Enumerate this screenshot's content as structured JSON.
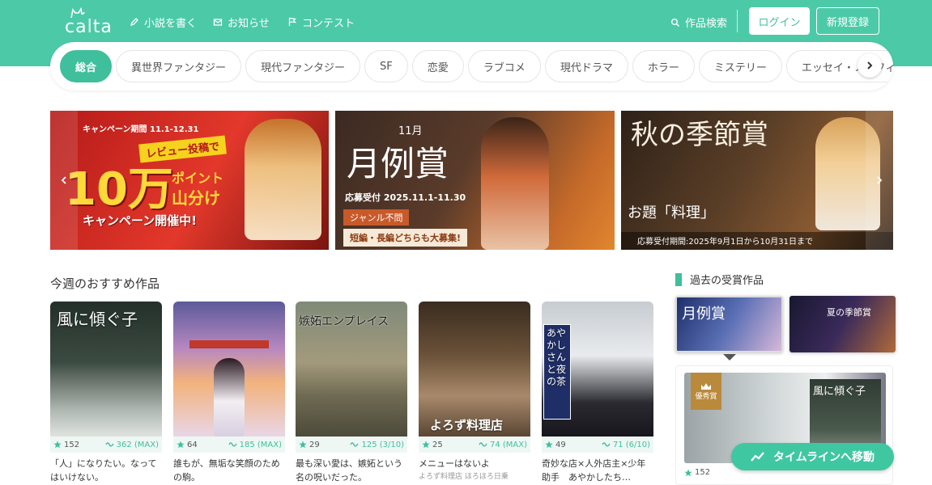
{
  "header": {
    "logo_text": "calta",
    "nav": [
      {
        "label": "小説を書く",
        "icon": "pen-icon"
      },
      {
        "label": "お知らせ",
        "icon": "mail-icon"
      },
      {
        "label": "コンテスト",
        "icon": "flag-icon"
      }
    ],
    "search_label": "作品検索",
    "login_label": "ログイン",
    "signup_label": "新規登録"
  },
  "genres": [
    "総合",
    "異世界ファンタジー",
    "現代ファンタジー",
    "SF",
    "恋愛",
    "ラブコメ",
    "現代ドラマ",
    "ホラー",
    "ミステリー",
    "エッセイ・ノンフィクション"
  ],
  "banners": [
    {
      "top": "キャンペーン期間 11.1-12.31",
      "main1": "レビュー投稿で",
      "main2": "10万",
      "main3": "ポイント",
      "main4": "山分け",
      "main5": "キャンペーン開催中!"
    },
    {
      "month": "11月",
      "title": "月例賞",
      "period": "応募受付 2025.11.1-11.30",
      "genre": "ジャンル不問",
      "note": "短編・長編どちらも大募集!"
    },
    {
      "title": "秋の季節賞",
      "theme": "お題「料理」",
      "period": "応募受付期間:2025年9月1日から10月31日まで"
    }
  ],
  "recommend": {
    "title": "今週のおすすめ作品",
    "items": [
      {
        "cover_title": "風に傾ぐ子",
        "stars": "152",
        "reactions": "362 (MAX)",
        "desc": "「人」になりたい。なってはいけない。",
        "sub": ""
      },
      {
        "cover_title": "",
        "stars": "64",
        "reactions": "185 (MAX)",
        "desc": "誰もが、無垢な笑顔のための駒。",
        "sub": ""
      },
      {
        "cover_title": "嫉妬エンプレイス",
        "stars": "29",
        "reactions": "125 (3/10)",
        "desc": "最も深い愛は、嫉妬という名の呪いだった。",
        "sub": ""
      },
      {
        "cover_title": "よろず料理店",
        "stars": "25",
        "reactions": "74 (MAX)",
        "desc": "メニューはないよ",
        "sub": "よろず料理店 ほろほろ日乗"
      },
      {
        "cover_title": "あやかしさんと夜の茶",
        "stars": "49",
        "reactions": "71 (6/10)",
        "desc": "奇妙な店×人外店主×少年助手　あやかしたち…",
        "sub": ""
      }
    ]
  },
  "awards": {
    "title": "過去の受賞作品",
    "thumb1": "月例賞",
    "thumb2": "夏の季節賞",
    "badge": "優秀賞",
    "cover_title": "風に傾ぐ子",
    "stars": "152"
  },
  "timeline_label": "タイムラインへ移動",
  "colors": {
    "accent": "#3fbf9c",
    "header": "#4ccaa8"
  }
}
